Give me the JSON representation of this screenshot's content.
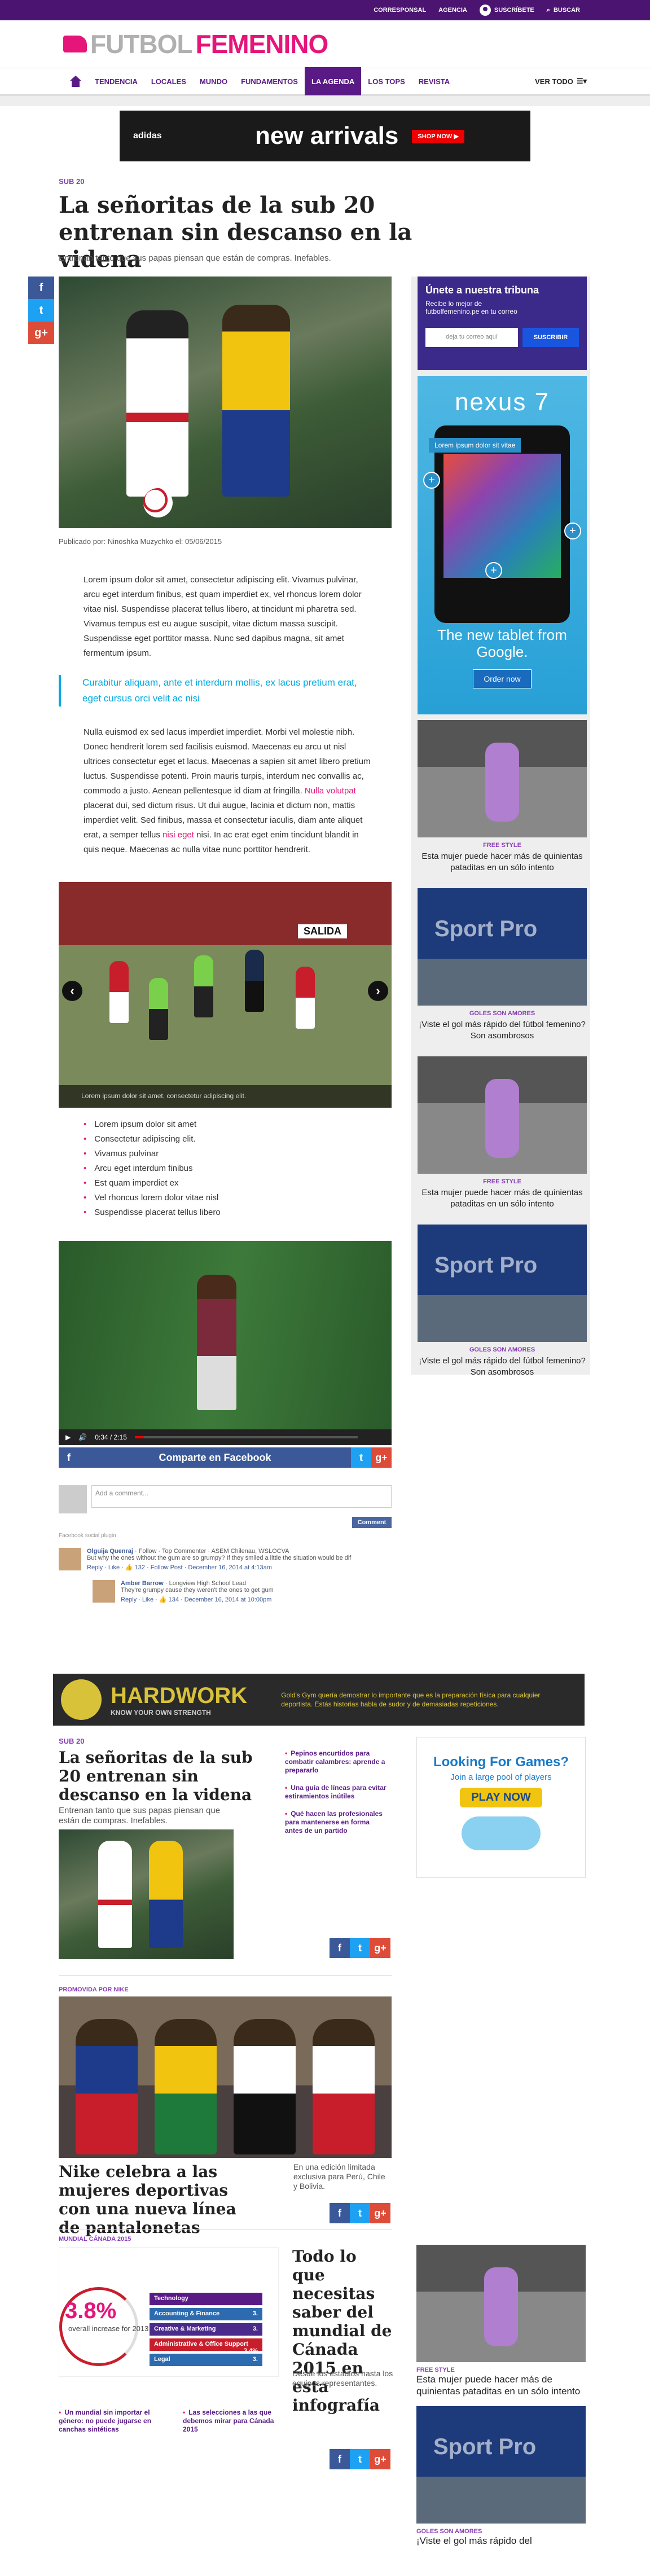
{
  "topbar": {
    "correspondal": "CORRESPONSAL",
    "agencia": "AGENCIA",
    "suscribete": "SUSCRÍBETE",
    "buscar": "BUSCAR"
  },
  "logo": {
    "part1": "FUTBOL",
    "part2": "FEMENINO"
  },
  "nav": {
    "items": [
      "TENDENCIA",
      "LOCALES",
      "MUNDO",
      "FUNDAMENTOS",
      "LA AGENDA",
      "LOS TOPS",
      "REVISTA"
    ],
    "ver_todo": "VER TODO"
  },
  "ad_top": {
    "brand": "adidas",
    "text": "new arrivals",
    "cta": "SHOP NOW ▶"
  },
  "article": {
    "category": "SUB 20",
    "title": "La señoritas de la sub 20 entrenan sin descanso en la videna",
    "subtitle": "Entrenan tanto que sus papas piensan que están de compras. Inefables.",
    "caption": "Publicado por: Ninoshka Muzychko el: 05/06/2015",
    "body1": "Lorem ipsum dolor sit amet, consectetur adipiscing elit. Vivamus pulvinar, arcu eget interdum finibus, est quam imperdiet ex, vel rhoncus lorem dolor vitae nisl. Suspendisse placerat tellus libero, at tincidunt mi pharetra sed. Vivamus tempus est eu augue suscipit, vitae dictum massa suscipit. Suspendisse eget porttitor massa. Nunc sed dapibus magna, sit amet fermentum ipsum.",
    "quote": "Curabitur aliquam, ante et interdum mollis, ex lacus pretium erat, eget cursus orci velit ac nisi",
    "body2a": "Nulla euismod ex sed lacus imperdiet imperdiet. Morbi vel molestie nibh. Donec hendrerit lorem sed facilisis euismod. Maecenas eu arcu ut nisl ultrices consectetur eget et lacus. Maecenas a sapien sit amet libero pretium luctus. Suspendisse potenti. Proin mauris turpis, interdum nec convallis ac, commodo a justo. Aenean pellentesque id diam at fringilla. ",
    "body2link": "Nulla volutpat",
    "body2b": " placerat dui, sed dictum risus. Ut dui augue, lacinia et dictum non, mattis imperdiet velit. Sed finibus, massa et consectetur iaculis, diam ante aliquet erat, a semper tellus ",
    "body2link2": "nisi eget",
    "body2c": " nisi. In ac erat eget enim tincidunt blandit in quis neque. Maecenas ac nulla vitae nunc porttitor hendrerit.",
    "slider_text": "SALIDA",
    "slider_caption": "Lorem ipsum dolor sit amet, consectetur adipiscing elit.",
    "bullets": [
      "Lorem ipsum dolor sit amet",
      "Consectetur adipiscing elit.",
      "Vivamus pulvinar",
      "Arcu eget interdum finibus",
      "Est quam imperdiet ex",
      "Vel rhoncus lorem dolor vitae nisl",
      "Suspendisse placerat tellus libero"
    ],
    "video_time": "0:34 / 2:15",
    "share": "Comparte en Facebook"
  },
  "comments": {
    "placeholder": "Add a comment...",
    "button": "Comment",
    "plugin": "Facebook social plugin",
    "c1_name": "Olguija Quenraj",
    "c1_meta_head": "· Follow · Top Commenter · ASEM Chilenau, WSLOCVA",
    "c1_text": "But why the ones without the gum are so grumpy? If they smiled a little the situation would be dif",
    "c1_meta": "Reply · Like · 👍 132 · Follow Post · December 16, 2014 at 4:13am",
    "c2_name": "Amber Barrow",
    "c2_meta_head": "· Longview High School Lead",
    "c2_text": "They're grumpy cause they weren't the ones to get gum",
    "c2_meta": "Reply · Like · 👍 134 · December 16, 2014 at 10:00pm"
  },
  "sidebar": {
    "nl_title": "Únete a nuestra tribuna",
    "nl_text": "Recibe lo mejor de futbolfemenino.pe en tu correo",
    "nl_placeholder": "deja tu correo aquí",
    "nl_button": "SUSCRIBIR",
    "nexus_logo": "nexus 7",
    "nexus_lorem": "Lorem ipsum dolor sit vitae",
    "nexus_tag": "The new tablet from Google.",
    "nexus_cta": "Order now",
    "cards": [
      {
        "cat": "FREE STYLE",
        "title": "Esta mujer puede hacer más de quinientas pataditas en un sólo intento"
      },
      {
        "cat": "GOLES SON AMORES",
        "title": "¡Viste el gol más rápido del fútbol femenino? Son asombrosos"
      },
      {
        "cat": "FREE STYLE",
        "title": "Esta mujer puede hacer más de quinientas pataditas en un sólo intento"
      },
      {
        "cat": "GOLES SON AMORES",
        "title": "¡Viste el gol más rápido del fútbol femenino? Son asombrosos"
      }
    ]
  },
  "hardwork": {
    "title": "HARDWORK",
    "tagline": "KNOW YOUR OWN STRENGTH",
    "text": "Gold's Gym quería demostrar lo importante que es la preparación física para cualquier deportista. Estás historias habla de sudor y de demasiadas repeticiones."
  },
  "module1": {
    "cat": "SUB 20",
    "title": "La señoritas de la sub 20 entrenan sin descanso en la videna",
    "subtitle": "Entrenan tanto que sus papas piensan que están de compras. Inefables.",
    "links": [
      "Pepinos encurtidos para combatir calambres: aprende a prepararlo",
      "Una guía de líneas para evitar estiramientos inútiles",
      "Qué hacen las profesionales para mantenerse en forma antes de un partido"
    ]
  },
  "games_ad": {
    "t1": "Looking For Games?",
    "t2": "Join a large pool of players",
    "cta": "PLAY NOW"
  },
  "module2": {
    "cat": "PROMOVIDA POR NIKE",
    "title": "Nike celebra a las mujeres deportivas con una nueva línea de pantalonetas",
    "text": "En una edición limitada exclusiva para Perú, Chile y Bolivia."
  },
  "module3": {
    "cat": "MUNDIAL CÁNADA 2015",
    "big": "3.8%",
    "overall": "overall increase for 2013",
    "bars": [
      {
        "label": "Technology",
        "value": "",
        "color": "#5a1a86"
      },
      {
        "label": "Accounting & Finance",
        "value": "3.",
        "color": "#2c6bb0"
      },
      {
        "label": "Creative & Marketing",
        "value": "3.",
        "color": "#4a2a8a"
      },
      {
        "label": "Administrative & Office Support",
        "value": "3.4%",
        "color": "#c81e2b"
      },
      {
        "label": "Legal",
        "value": "3.",
        "color": "#2c6bb0"
      }
    ],
    "title": "Todo lo que necesitas saber del mundial de Cánada 2015 en esta infografía",
    "text": "Desde los estadios hasta los equipos representantes.",
    "links": [
      "Un mundial sin importar el género: no puede jugarse en canchas sintéticas",
      "Las selecciones a las que debemos mirar para Cánada 2015"
    ]
  },
  "rside": {
    "cat1": "FREE STYLE",
    "t1": "Esta mujer puede hacer más de quinientas pataditas en un sólo intento",
    "cat2": "GOLES SON AMORES",
    "t2": "¡Viste el gol más rápido del"
  },
  "colors": {
    "brand_purple": "#4a1470",
    "pink": "#e5157a",
    "facebook": "#3b5998",
    "twitter": "#1da1f2",
    "gplus": "#dd4b39"
  }
}
